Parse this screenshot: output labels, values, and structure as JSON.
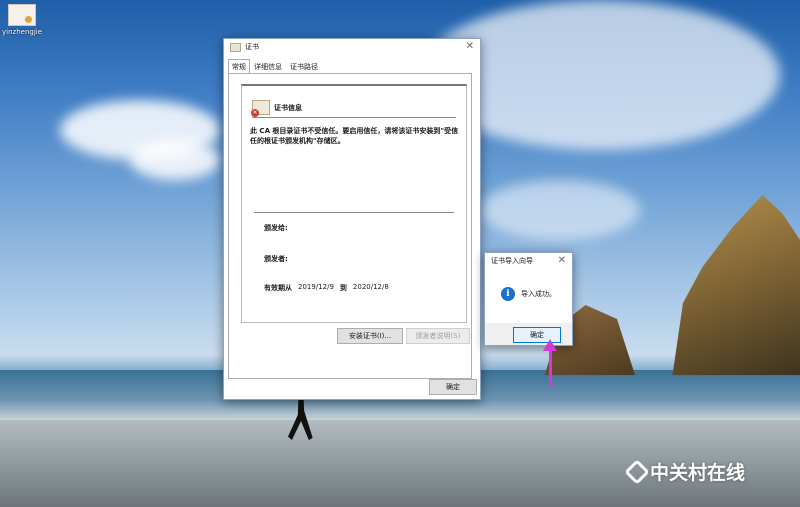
{
  "desktop": {
    "icon_label": "yinzhengjie"
  },
  "cert_dialog": {
    "title": "证书",
    "tabs": [
      "常规",
      "详细信息",
      "证书路径"
    ],
    "header": "证书信息",
    "warning": "此 CA 根目录证书不受信任。要启用信任，请将该证书安装到\"受信任的根证书颁发机构\"存储区。",
    "issued_to_label": "颁发给:",
    "issued_by_label": "颁发者:",
    "valid_from_label": "有效期从",
    "valid_from": "2019/12/9",
    "valid_to_label": "到",
    "valid_to": "2020/12/8",
    "install_button": "安装证书(I)...",
    "issuer_statement_button": "颁发者说明(S)",
    "ok_button": "确定"
  },
  "import_popup": {
    "title": "证书导入向导",
    "message": "导入成功。",
    "ok_button": "确定"
  },
  "watermark": "中关村在线",
  "colors": {
    "annotation_arrow": "#d23ad6",
    "info_icon": "#1d6fce"
  }
}
